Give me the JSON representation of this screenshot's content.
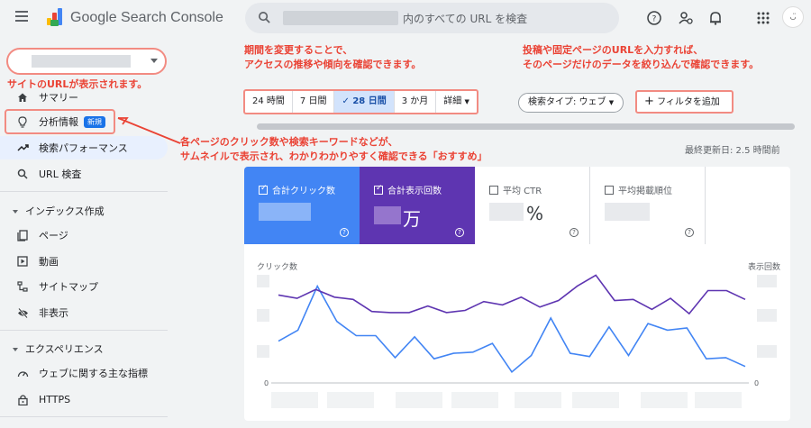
{
  "header": {
    "app_title": "Google Search Console",
    "search_placeholder": "内のすべての URL を検査"
  },
  "sidebar": {
    "summary": "サマリー",
    "insights": "分析情報",
    "insights_badge": "新規",
    "performance": "検索パフォーマンス",
    "url_inspection": "URL 検査",
    "section_index": "インデックス作成",
    "pages": "ページ",
    "videos": "動画",
    "sitemaps": "サイトマップ",
    "removals": "非表示",
    "section_experience": "エクスペリエンス",
    "cwv": "ウェブに関する主な指標",
    "https": "HTTPS"
  },
  "annotations": {
    "site_url": "サイトのURLが表示されます。",
    "period_1": "期間を変更することで、",
    "period_2": "アクセスの推移や傾向を確認できます。",
    "filter_1": "投稿や固定ページのURLを入力すれば、",
    "filter_2": "そのページだけのデータを絞り込んで確認できます。",
    "insights_1": "各ページのクリック数や検索キーワードなどが、",
    "insights_2": "サムネイルで表示され、わかりわかりやすく確認できる「おすすめ」"
  },
  "toolbar": {
    "ranges": [
      "24 時間",
      "7 日間",
      "28 日間",
      "3 か月",
      "詳細"
    ],
    "selected_range": "28 日間",
    "search_type": "検索タイプ: ウェブ",
    "add_filter": "フィルタを追加",
    "last_updated": "最終更新日: 2.5 時間前"
  },
  "metrics": {
    "clicks_label": "合計クリック数",
    "impressions_label": "合計表示回数",
    "impressions_suffix": "万",
    "ctr_label": "平均 CTR",
    "ctr_suffix": "%",
    "position_label": "平均掲載順位"
  },
  "chart_data": {
    "type": "line",
    "left_axis_label": "クリック数",
    "right_axis_label": "表示回数",
    "left_min_label": "0",
    "right_min_label": "0",
    "series": [
      {
        "name": "合計クリック数",
        "color": "#4285f4",
        "values": [
          0.38,
          0.48,
          0.88,
          0.56,
          0.43,
          0.43,
          0.23,
          0.42,
          0.22,
          0.27,
          0.28,
          0.36,
          0.1,
          0.25,
          0.59,
          0.27,
          0.24,
          0.51,
          0.25,
          0.54,
          0.48,
          0.5,
          0.22,
          0.23,
          0.15
        ]
      },
      {
        "name": "合計表示回数",
        "color": "#5e35b1",
        "values": [
          0.8,
          0.77,
          0.85,
          0.78,
          0.76,
          0.65,
          0.64,
          0.64,
          0.7,
          0.64,
          0.66,
          0.74,
          0.71,
          0.78,
          0.69,
          0.75,
          0.88,
          0.98,
          0.75,
          0.76,
          0.67,
          0.77,
          0.63,
          0.84,
          0.84,
          0.76
        ]
      }
    ]
  }
}
